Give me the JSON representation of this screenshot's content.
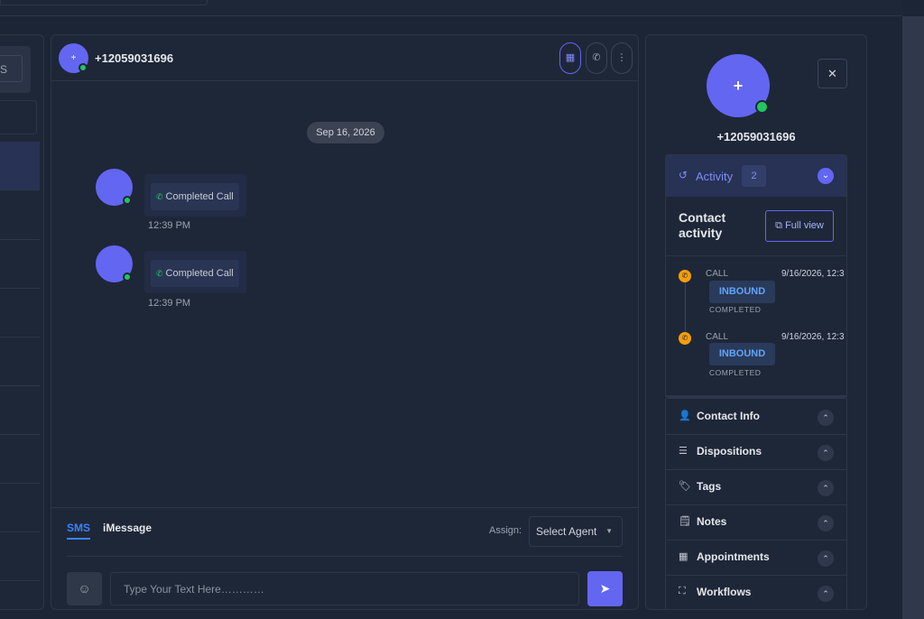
{
  "left": {
    "box_text": "S"
  },
  "chat": {
    "avatar_glyph": "+",
    "contact_number": "+12059031696",
    "header_buttons": {
      "grid_icon": "▦",
      "phone_icon": "✆",
      "more_icon": "⋮"
    },
    "date_pill": "Sep 16, 2026",
    "messages": [
      {
        "label": "Completed Call",
        "time": "12:39 PM",
        "icon": "✆"
      },
      {
        "label": "Completed Call",
        "time": "12:39 PM",
        "icon": "✆"
      }
    ]
  },
  "composer": {
    "tabs": [
      "SMS",
      "iMessage"
    ],
    "assign_label": "Assign:",
    "agent_select_value": "Select Agent",
    "caret": "▼",
    "emoji_icon": "☺",
    "input_placeholder": "Type Your Text Here…………",
    "send_icon": "➤"
  },
  "contact": {
    "avatar_glyph": "+",
    "name": "+12059031696",
    "close_icon": "✕"
  },
  "activity": {
    "icon": "↺",
    "label": "Activity",
    "count": "2",
    "toggle_icon": "⌄",
    "title": "Contact activity",
    "full_view_icon": "⧉",
    "full_view_label": "Full view",
    "items": [
      {
        "type": "CALL",
        "date": "9/16/2026, 12:3",
        "direction": "INBOUND",
        "status": "COMPLETED",
        "icon": "✆"
      },
      {
        "type": "CALL",
        "date": "9/16/2026, 12:3",
        "direction": "INBOUND",
        "status": "COMPLETED",
        "icon": "✆"
      }
    ]
  },
  "sections": [
    {
      "label": "Contact Info",
      "icon": "👤"
    },
    {
      "label": "Dispositions",
      "icon": "☰"
    },
    {
      "label": "Tags",
      "icon": "🏷"
    },
    {
      "label": "Notes",
      "icon": "🗒"
    },
    {
      "label": "Appointments",
      "icon": "▦"
    },
    {
      "label": "Workflows",
      "icon": "⛶"
    }
  ],
  "section_chevron": "⌃",
  "colors": {
    "accent": "#6366f1",
    "online": "#22c55e",
    "call_badge": "#f59e0b",
    "link_blue": "#3b82f6"
  }
}
